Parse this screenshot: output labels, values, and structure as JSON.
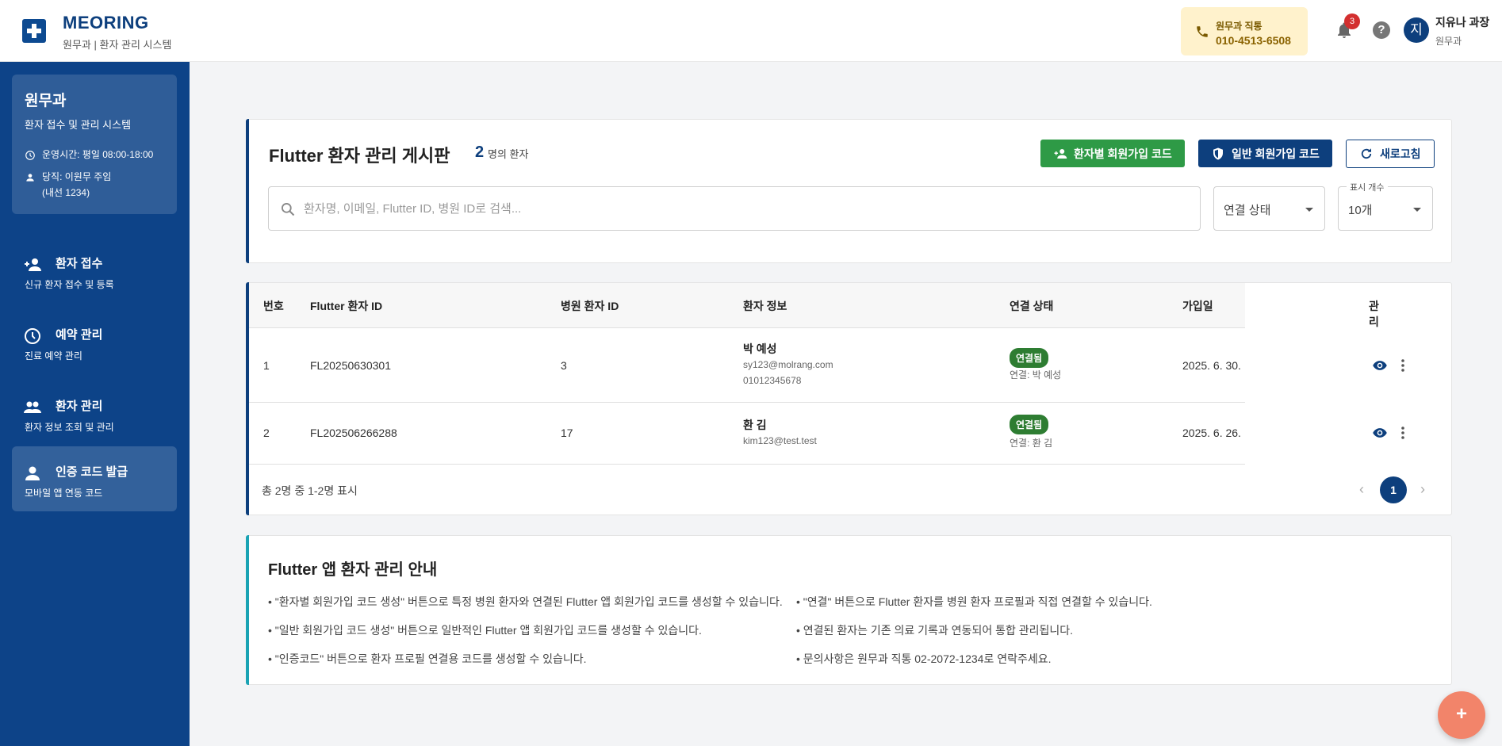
{
  "header": {
    "brand": "MEORING",
    "subtitle": "원무과 | 환자 관리 시스템",
    "hotline_label": "원무과 직통",
    "hotline_number": "010-4513-6508",
    "notification_count": "3",
    "help_icon": "?",
    "avatar_initial": "지",
    "user_name": "지유나 과장",
    "user_dept": "원무과"
  },
  "sidebar": {
    "dept_title": "원무과",
    "dept_subtitle": "환자 접수 및 관리 시스템",
    "hours": "운영시간: 평일 08:00-18:00",
    "duty_line1": "당직: 이원무 주임",
    "duty_line2": "(내선 1234)",
    "items": [
      {
        "label": "환자 접수",
        "sub": "신규 환자 접수 및 등록",
        "icon": "person-add-icon"
      },
      {
        "label": "예약 관리",
        "sub": "진료 예약 관리",
        "icon": "clock-icon"
      },
      {
        "label": "환자 관리",
        "sub": "환자 정보 조회 및 관리",
        "icon": "people-icon"
      },
      {
        "label": "인증 코드 발급",
        "sub": "모바일 앱 연동 코드",
        "icon": "person-icon",
        "active": true
      }
    ]
  },
  "board": {
    "title": "Flutter 환자 관리 게시판",
    "count": "2",
    "count_label": "명의 환자",
    "btn_patient_code": "환자별 회원가입 코드",
    "btn_general_code": "일반 회원가입 코드",
    "btn_refresh": "새로고침",
    "search_placeholder": "환자명, 이메일, Flutter ID, 병원 ID로 검색...",
    "status_select": "연결 상태",
    "page_size_label": "표시 개수",
    "page_size": "10개"
  },
  "table": {
    "headers": [
      "번호",
      "Flutter 환자 ID",
      "병원 환자 ID",
      "환자 정보",
      "연결 상태",
      "가입일",
      "관리"
    ],
    "rows": [
      {
        "no": "1",
        "flutter_id": "FL20250630301",
        "hospital_id": "3",
        "name": "박 예성",
        "email": "sy123@molrang.com",
        "phone": "01012345678",
        "status": "연결됨",
        "linked": "연결: 박 예성",
        "joined": "2025. 6. 30."
      },
      {
        "no": "2",
        "flutter_id": "FL202506266288",
        "hospital_id": "17",
        "name": "환 김",
        "email": "kim123@test.test",
        "phone": "",
        "status": "연결됨",
        "linked": "연결: 환 김",
        "joined": "2025. 6. 26."
      }
    ],
    "footer": "총 2명 중 1-2명 표시",
    "current_page": "1"
  },
  "guide": {
    "title": "Flutter 앱 환자 관리 안내",
    "left": [
      "• \"환자별 회원가입 코드 생성\" 버튼으로 특정 병원 환자와 연결된 Flutter 앱 회원가입 코드를 생성할 수 있습니다.",
      "• \"일반 회원가입 코드 생성\" 버튼으로 일반적인 Flutter 앱 회원가입 코드를 생성할 수 있습니다.",
      "• \"인증코드\" 버튼으로 환자 프로필 연결용 코드를 생성할 수 있습니다."
    ],
    "right": [
      "• \"연결\" 버튼으로 Flutter 환자를 병원 환자 프로필과 직접 연결할 수 있습니다.",
      "• 연결된 환자는 기존 의료 기록과 연동되어 통합 관리됩니다.",
      "• 문의사항은 원무과 직통 02-2072-1234로 연락주세요."
    ]
  },
  "fab_label": "+",
  "colors": {
    "primary": "#0d3f7d",
    "green": "#2e9a46",
    "badge": "#2e7d32",
    "fab": "#f2846a",
    "hotline_bg": "#fff2cc"
  }
}
